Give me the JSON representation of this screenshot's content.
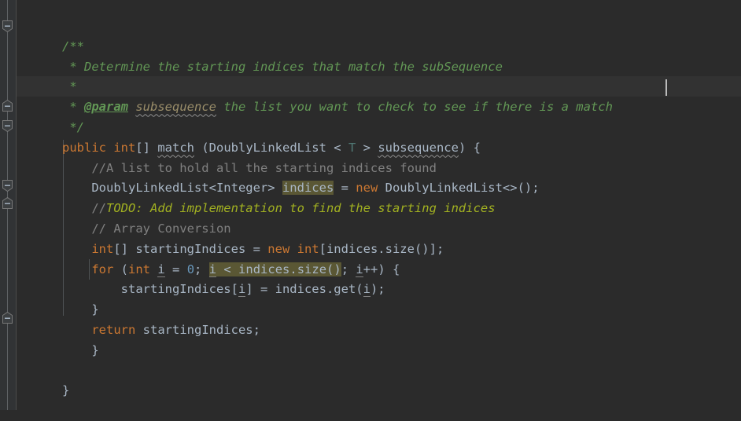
{
  "editor": {
    "theme": "darcula",
    "background": "#2b2b2b",
    "gutter_background": "#313335",
    "current_line_background": "#323232",
    "caret_color": "#bbbbbb",
    "identifier_highlight_color": "#5a5734",
    "colors": {
      "keyword": "#cc7832",
      "default_text": "#a9b7c6",
      "line_comment": "#808080",
      "javadoc": "#629755",
      "javadoc_param_name": "#9b8e6a",
      "todo": "#a1b021",
      "number": "#6897bb",
      "type_parameter": "#507874",
      "warning_squiggle": "#909090",
      "indent_guide": "#4f5355",
      "fold_rail": "#606366"
    },
    "caret_line_index": 3,
    "caret_column_text": "match"
  },
  "gutter": {
    "fold_markers": [
      {
        "name": "fold-marker-javadoc-start",
        "state": "expanded",
        "line": 0
      },
      {
        "name": "fold-marker-javadoc-end",
        "state": "expanded",
        "line": 4
      },
      {
        "name": "fold-marker-method-start",
        "state": "expanded",
        "line": 5
      },
      {
        "name": "fold-marker-for-start",
        "state": "expanded",
        "line": 11
      },
      {
        "name": "fold-marker-for-end",
        "state": "expanded",
        "line": 12
      },
      {
        "name": "fold-marker-class-end",
        "state": "expanded",
        "line": 17
      }
    ]
  },
  "code": {
    "lines": [
      {
        "index": 0,
        "name": "code-line-javadoc-open",
        "text": "/**"
      },
      {
        "index": 1,
        "name": "code-line-javadoc-description",
        "text": " * Determine the starting indices that match the subSequence"
      },
      {
        "index": 2,
        "name": "code-line-javadoc-blank",
        "text": " *"
      },
      {
        "index": 3,
        "name": "code-line-javadoc-param",
        "text": " * @param subsequence the list you want to check to see if there is a match",
        "tag": "@param",
        "param_name": "subsequence",
        "param_description": "the list you want to check to see if there is a match",
        "is_current_line": true
      },
      {
        "index": 4,
        "name": "code-line-javadoc-close",
        "text": " */"
      },
      {
        "index": 5,
        "name": "code-line-method-signature",
        "text": "public int[] match (DoublyLinkedList < T > subsequence) {"
      },
      {
        "index": 6,
        "name": "code-line-comment-list-hold",
        "text": "    //A list to hold all the starting indices found"
      },
      {
        "index": 7,
        "name": "code-line-declare-indices",
        "text": "    DoublyLinkedList<Integer> indices = new DoublyLinkedList<>();"
      },
      {
        "index": 8,
        "name": "code-line-todo",
        "text": "    //TODO: Add implementation to find the starting indices"
      },
      {
        "index": 9,
        "name": "code-line-comment-array-conversion",
        "text": "    // Array Conversion"
      },
      {
        "index": 10,
        "name": "code-line-declare-startingindices",
        "text": "    int[] startingIndices = new int[indices.size()];"
      },
      {
        "index": 11,
        "name": "code-line-for-loop",
        "text": "    for (int i = 0; i < indices.size(); i++) {"
      },
      {
        "index": 12,
        "name": "code-line-assign-element",
        "text": "        startingIndices[i] = indices.get(i);"
      },
      {
        "index": 13,
        "name": "code-line-for-close-brace",
        "text": "    }"
      },
      {
        "index": 14,
        "name": "code-line-return",
        "text": "    return startingIndices;"
      },
      {
        "index": 15,
        "name": "code-line-method-close-brace",
        "text": "    }"
      },
      {
        "index": 16,
        "name": "code-line-blank",
        "text": ""
      },
      {
        "index": 17,
        "name": "code-line-class-close-brace",
        "text": "}"
      }
    ],
    "highlighted_occurrences": [
      "indices",
      "i < indices.size()"
    ],
    "warning_squiggles": [
      "match",
      "subsequence"
    ]
  }
}
